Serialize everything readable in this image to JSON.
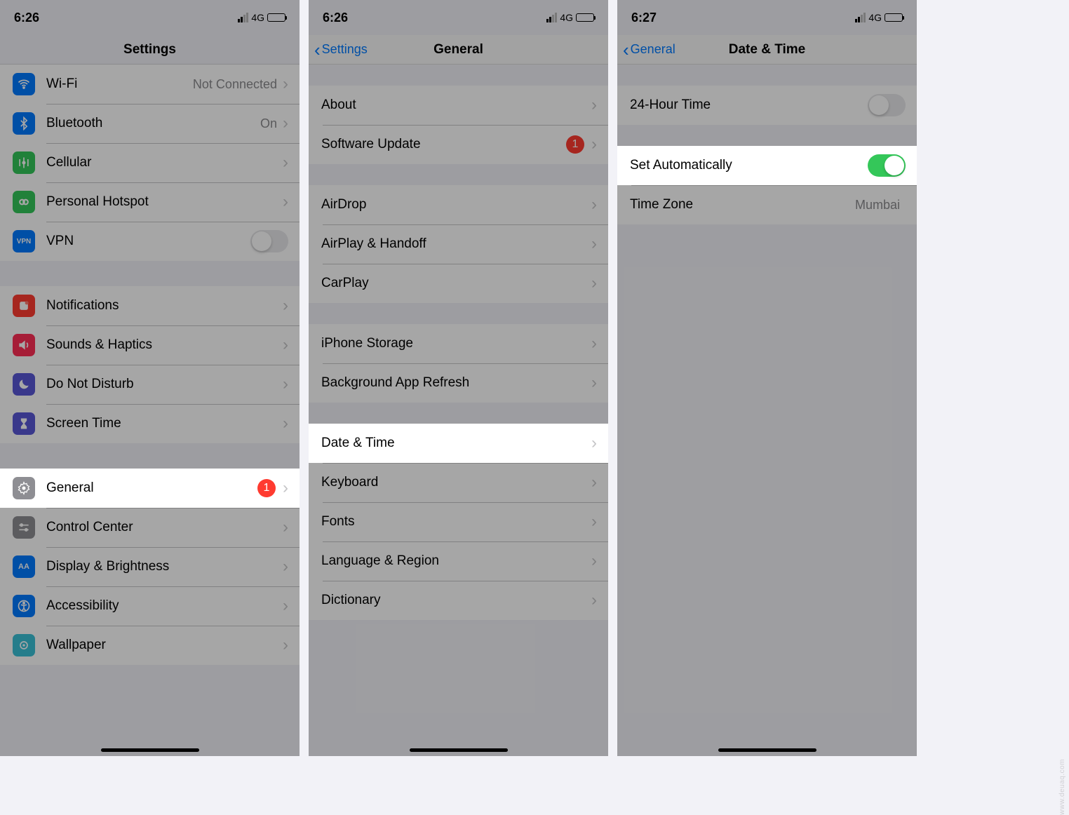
{
  "watermark": "www.deuaq.com",
  "screen1": {
    "time": "6:26",
    "net": "4G",
    "title": "Settings",
    "rows1": [
      {
        "label": "Wi-Fi",
        "value": "Not Connected",
        "icon": "wifi",
        "color": "#007aff"
      },
      {
        "label": "Bluetooth",
        "value": "On",
        "icon": "bluetooth",
        "color": "#007aff"
      },
      {
        "label": "Cellular",
        "icon": "cellular",
        "color": "#34c759"
      },
      {
        "label": "Personal Hotspot",
        "icon": "hotspot",
        "color": "#34c759"
      },
      {
        "label": "VPN",
        "icon": "vpn",
        "color": "#007aff",
        "toggle": false
      }
    ],
    "rows2": [
      {
        "label": "Notifications",
        "icon": "notifications",
        "color": "#ff3b30"
      },
      {
        "label": "Sounds & Haptics",
        "icon": "sounds",
        "color": "#ff3b30"
      },
      {
        "label": "Do Not Disturb",
        "icon": "dnd",
        "color": "#5856d6"
      },
      {
        "label": "Screen Time",
        "icon": "screentime",
        "color": "#5856d6"
      }
    ],
    "rows3": [
      {
        "label": "General",
        "icon": "general",
        "color": "#8e8e93",
        "badge": "1",
        "highlight": true
      },
      {
        "label": "Control Center",
        "icon": "control",
        "color": "#8e8e93"
      },
      {
        "label": "Display & Brightness",
        "icon": "display",
        "color": "#007aff"
      },
      {
        "label": "Accessibility",
        "icon": "accessibility",
        "color": "#007aff"
      },
      {
        "label": "Wallpaper",
        "icon": "wallpaper",
        "color": "#34bed1"
      }
    ]
  },
  "screen2": {
    "time": "6:26",
    "net": "4G",
    "back": "Settings",
    "title": "General",
    "g1": [
      {
        "label": "About"
      },
      {
        "label": "Software Update",
        "badge": "1"
      }
    ],
    "g2": [
      {
        "label": "AirDrop"
      },
      {
        "label": "AirPlay & Handoff"
      },
      {
        "label": "CarPlay"
      }
    ],
    "g3": [
      {
        "label": "iPhone Storage"
      },
      {
        "label": "Background App Refresh"
      }
    ],
    "g4": [
      {
        "label": "Date & Time",
        "highlight": true
      },
      {
        "label": "Keyboard"
      },
      {
        "label": "Fonts"
      },
      {
        "label": "Language & Region"
      },
      {
        "label": "Dictionary"
      }
    ]
  },
  "screen3": {
    "time": "6:27",
    "net": "4G",
    "back": "General",
    "title": "Date & Time",
    "row_24h": {
      "label": "24-Hour Time",
      "on": false
    },
    "row_auto": {
      "label": "Set Automatically",
      "on": true,
      "highlight": true
    },
    "row_tz": {
      "label": "Time Zone",
      "value": "Mumbai"
    }
  }
}
